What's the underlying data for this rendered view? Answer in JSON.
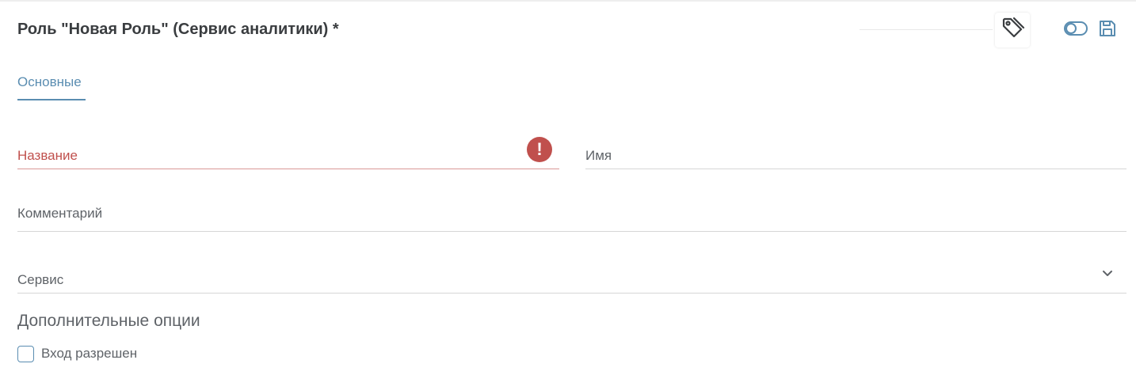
{
  "header": {
    "title": "Роль \"Новая Роль\" (Сервис аналитики) *",
    "icons": [
      "tag-icon",
      "toggle-icon",
      "save-icon"
    ]
  },
  "tabs": [
    {
      "label": "Основные",
      "active": true
    }
  ],
  "form": {
    "name_label": "Название",
    "name_error": "!",
    "imya_label": "Имя",
    "comment_label": "Комментарий",
    "service_label": "Сервис"
  },
  "options": {
    "section_title": "Дополнительные опции",
    "login_allowed_label": "Вход разрешен",
    "login_allowed_checked": false
  },
  "colors": {
    "accent": "#5a8db1",
    "error": "#c0504d",
    "text": "#3a3d40",
    "muted": "#5f6368"
  }
}
